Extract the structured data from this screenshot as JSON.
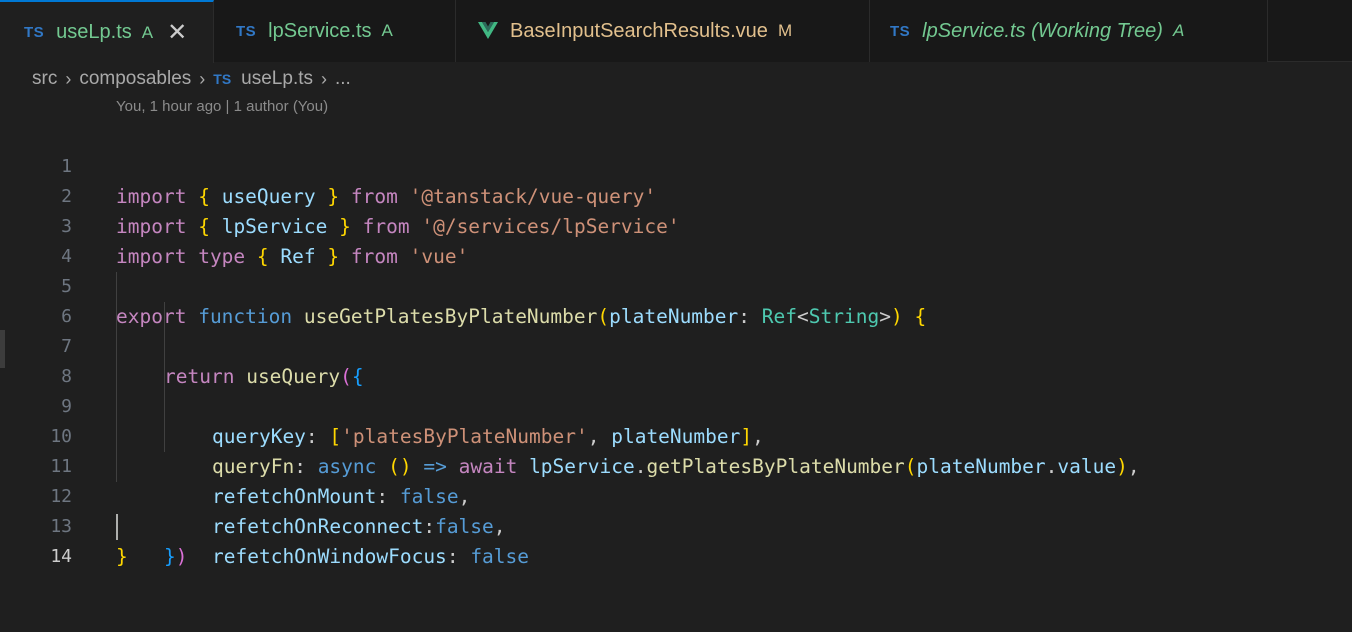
{
  "tabs": [
    {
      "badge": "TS",
      "name": "useLp.ts",
      "status": "A",
      "active": true,
      "close": "✕"
    },
    {
      "badge": "TS",
      "name": "lpService.ts",
      "status": "A"
    },
    {
      "name": "BaseInputSearchResults.vue",
      "status": "M"
    },
    {
      "badge": "TS",
      "name": "lpService.ts (Working Tree)",
      "status": "A"
    }
  ],
  "breadcrumb": {
    "items": [
      "src",
      "composables",
      "useLp.ts",
      "..."
    ],
    "badge": "TS",
    "sep": "›"
  },
  "blame": "You, 1 hour ago | 1 author (You)",
  "code": {
    "line_numbers": [
      "1",
      "2",
      "3",
      "4",
      "5",
      "6",
      "7",
      "8",
      "9",
      "10",
      "11",
      "12",
      "13",
      "14"
    ],
    "l1": {
      "import": "import",
      "ob": "{",
      "name": "useQuery",
      "cb": "}",
      "from": "from",
      "str": "'@tanstack/vue-query'"
    },
    "l2": {
      "import": "import",
      "ob": "{",
      "name": "lpService",
      "cb": "}",
      "from": "from",
      "str": "'@/services/lpService'"
    },
    "l3": {
      "import": "import",
      "type": "type",
      "ob": "{",
      "name": "Ref",
      "cb": "}",
      "from": "from",
      "str": "'vue'"
    },
    "l5": {
      "export": "export",
      "function": "function",
      "fname": "useGetPlatesByPlateNumber",
      "op": "(",
      "param": "plateNumber",
      "colon": ":",
      "rtype": "Ref",
      "lt": "<",
      "gtype": "String",
      "gt": ">",
      "cp": ")",
      "ob": "{"
    },
    "l6": {
      "return": "return",
      "fname": "useQuery",
      "op": "(",
      "ob": "{"
    },
    "l7": {
      "key": "queryKey",
      "colon": ":",
      "ob": "[",
      "str": "'platesByPlateNumber'",
      "comma": ",",
      "var": "plateNumber",
      "cb": "]",
      "end": ","
    },
    "l8": {
      "key": "queryFn",
      "colon": ":",
      "async": "async",
      "parens": "()",
      "arrow": "=>",
      "await": "await",
      "obj": "lpService",
      "dot": ".",
      "method": "getPlatesByPlateNumber",
      "op": "(",
      "var": "plateNumber",
      "dot2": ".",
      "prop": "value",
      "cp": ")",
      "end": ","
    },
    "l9": {
      "key": "refetchOnMount",
      "colon": ":",
      "val": "false",
      "end": ","
    },
    "l10": {
      "key": "refetchOnReconnect",
      "colon": ":",
      "val": "false",
      "end": ","
    },
    "l11": {
      "key": "refetchOnWindowFocus",
      "colon": ":",
      "val": "false"
    },
    "l12": {
      "cb": "}",
      "cp": ")"
    },
    "l13": {
      "cb": "}"
    }
  }
}
